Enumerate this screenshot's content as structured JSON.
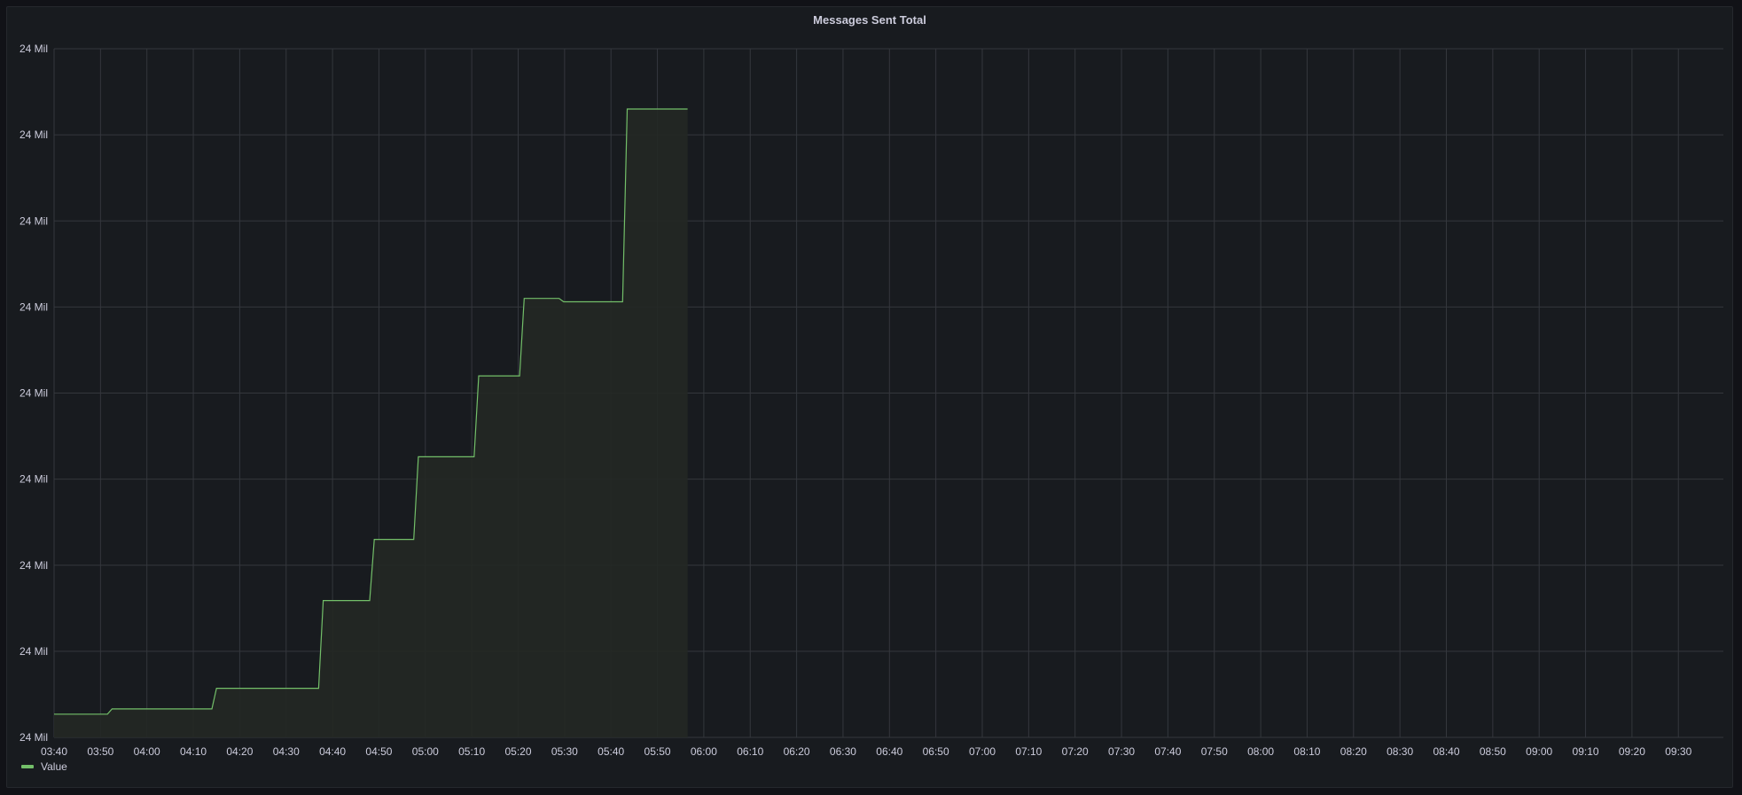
{
  "panel": {
    "title": "Messages Sent Total"
  },
  "colors": {
    "background": "#181b1f",
    "grid": "#34373d",
    "series_line": "#73bf69",
    "series_fill": "#242824",
    "text": "#ccccdc"
  },
  "chart_data": {
    "type": "area",
    "title": "Messages Sent Total",
    "xlabel": "",
    "ylabel": "",
    "grid": true,
    "legend_placement": "bottom-left",
    "x_ticks": [
      "03:40",
      "03:50",
      "04:00",
      "04:10",
      "04:20",
      "04:30",
      "04:40",
      "04:50",
      "05:00",
      "05:10",
      "05:20",
      "05:30",
      "05:40",
      "05:50",
      "06:00",
      "06:10",
      "06:20",
      "06:30",
      "06:40",
      "06:50",
      "07:00",
      "07:10",
      "07:20",
      "07:30",
      "07:40",
      "07:50",
      "08:00",
      "08:10",
      "08:20",
      "08:30",
      "08:40",
      "08:50",
      "09:00",
      "09:10",
      "09:20",
      "09:30"
    ],
    "y_tick_labels": [
      "24 Mil",
      "24 Mil",
      "24 Mil",
      "24 Mil",
      "24 Mil",
      "24 Mil",
      "24 Mil",
      "24 Mil",
      "24 Mil"
    ],
    "y_ticks": [
      0,
      1,
      2,
      3,
      4,
      5,
      6,
      7,
      8
    ],
    "ylim": [
      0,
      8
    ],
    "xlim_minutes": [
      220,
      357
    ],
    "series": [
      {
        "name": "Value",
        "color": "#73bf69",
        "x_minutes": [
          220,
          231.5,
          232.5,
          254,
          255,
          277,
          278,
          288,
          289,
          297.5,
          298.5,
          310.5,
          311.5,
          320.3,
          321.3,
          328.8,
          329.8,
          342.5,
          343.5,
          356.5
        ],
        "values": [
          0.27,
          0.27,
          0.33,
          0.33,
          0.57,
          0.57,
          1.59,
          1.59,
          2.3,
          2.3,
          3.26,
          3.26,
          4.2,
          4.2,
          5.1,
          5.1,
          5.06,
          5.06,
          7.3,
          7.3
        ]
      }
    ]
  },
  "legend": {
    "label": "Value"
  }
}
